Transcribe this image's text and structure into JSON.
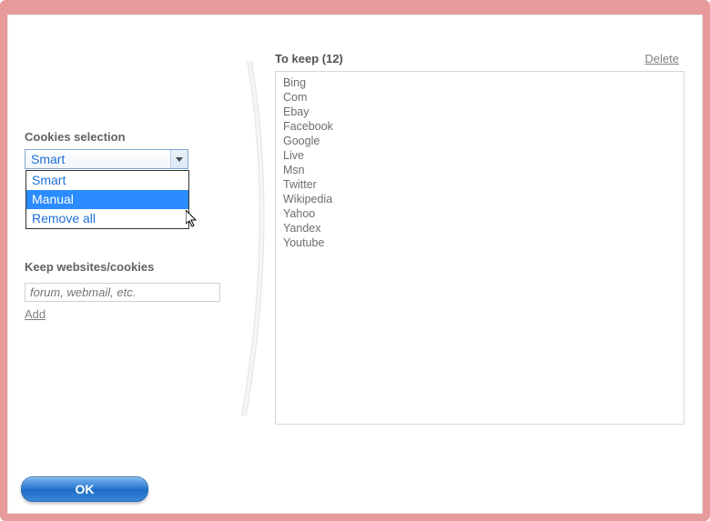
{
  "left": {
    "selection_heading": "Cookies selection",
    "combo_value": "Smart",
    "options": [
      "Smart",
      "Manual",
      "Remove all"
    ],
    "highlighted_index": 1,
    "keep_heading": "Keep websites/cookies",
    "keep_placeholder": "forum, webmail, etc.",
    "keep_value": "",
    "add_label": "Add"
  },
  "right": {
    "title": "To keep (12)",
    "delete_label": "Delete",
    "items": [
      "Bing",
      "Com",
      "Ebay",
      "Facebook",
      "Google",
      "Live",
      "Msn",
      "Twitter",
      "Wikipedia",
      "Yahoo",
      "Yandex",
      "Youtube"
    ]
  },
  "footer": {
    "ok_label": "OK"
  }
}
